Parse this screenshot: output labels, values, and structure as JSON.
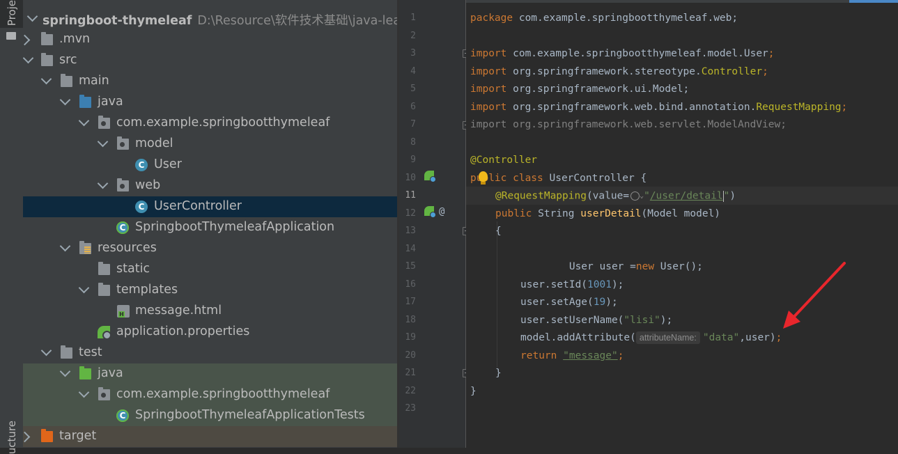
{
  "sidebar": {
    "project_tab": "Proje",
    "structure_tab": "ucture"
  },
  "project_tree": {
    "rows": [
      {
        "label": "springboot-thymeleaf",
        "path": "D:\\Resource\\软件技术基础\\java-learn"
      },
      {
        "label": ".mvn"
      },
      {
        "label": "src"
      },
      {
        "label": "main"
      },
      {
        "label": "java"
      },
      {
        "label": "com.example.springbootthymeleaf"
      },
      {
        "label": "model"
      },
      {
        "label": "User"
      },
      {
        "label": "web"
      },
      {
        "label": "UserController"
      },
      {
        "label": "SpringbootThymeleafApplication"
      },
      {
        "label": "resources"
      },
      {
        "label": "static"
      },
      {
        "label": "templates"
      },
      {
        "label": "message.html"
      },
      {
        "label": "application.properties"
      },
      {
        "label": "test"
      },
      {
        "label": "java"
      },
      {
        "label": "com.example.springbootthymeleaf"
      },
      {
        "label": "SpringbootThymeleafApplicationTests"
      },
      {
        "label": "target"
      }
    ]
  },
  "editor": {
    "line_numbers": [
      "1",
      "2",
      "3",
      "4",
      "5",
      "6",
      "7",
      "8",
      "9",
      "10",
      "11",
      "12",
      "13",
      "14",
      "15",
      "16",
      "17",
      "18",
      "19",
      "20",
      "21",
      "22",
      "23"
    ],
    "current_line": "11",
    "code": {
      "l1_kw": "package",
      "l1_rest": " com.example.springbootthymeleaf.web;",
      "l3_kw": "import",
      "l3_rest": " com.example.springbootthymeleaf.model.",
      "l3_cls": "User",
      "l3_end": ";",
      "l4_kw": "import",
      "l4_rest": " org.springframework.stereotype.",
      "l4_cls": "Controller",
      "l4_end": ";",
      "l5_kw": "import",
      "l5_rest": " org.springframework.ui.Model;",
      "l6_kw": "import",
      "l6_rest": " org.springframework.web.bind.annotation.",
      "l6_cls": "RequestMapping",
      "l6_end": ";",
      "l7": "import org.springframework.web.servlet.ModelAndView;",
      "l9": "@Controller",
      "l10_kw": "public class",
      "l10_rest": " UserController {",
      "l11_ann": "@RequestMapping",
      "l11_a": "(value=",
      "l11_str1": "\"",
      "l11_str2": "/user/detail",
      "l11_str3": "\"",
      "l11_end": ")",
      "l12_kw": "public",
      "l12_a": " String ",
      "l12_meth": "userDetail",
      "l12_b": "(Model model)",
      "l13": "{",
      "l15_a": "        User user =",
      "l15_kw": "new",
      "l15_b": " User();",
      "l16_a": "user.setId(",
      "l16_num": "1001",
      "l16_b": ");",
      "l17_a": "user.setAge(",
      "l17_num": "19",
      "l17_b": ");",
      "l18_a": "user.setUserName(",
      "l18_str": "\"lisi\"",
      "l18_b": ");",
      "l19_a": "model.addAttribute(",
      "l19_hint": "attributeName:",
      "l19_str": "\"data\"",
      "l19_b": ",user)",
      "l19_end": ";",
      "l20_kw": "return",
      "l20_str": "\"message\"",
      "l20_end": ";",
      "l21": "}",
      "l22": "}"
    }
  },
  "colors": {
    "keyword": "#cc7832",
    "annotation": "#bbb529",
    "string": "#6a8759",
    "number": "#6897bb",
    "method": "#ffc66d",
    "arrow": "#e8262c"
  }
}
